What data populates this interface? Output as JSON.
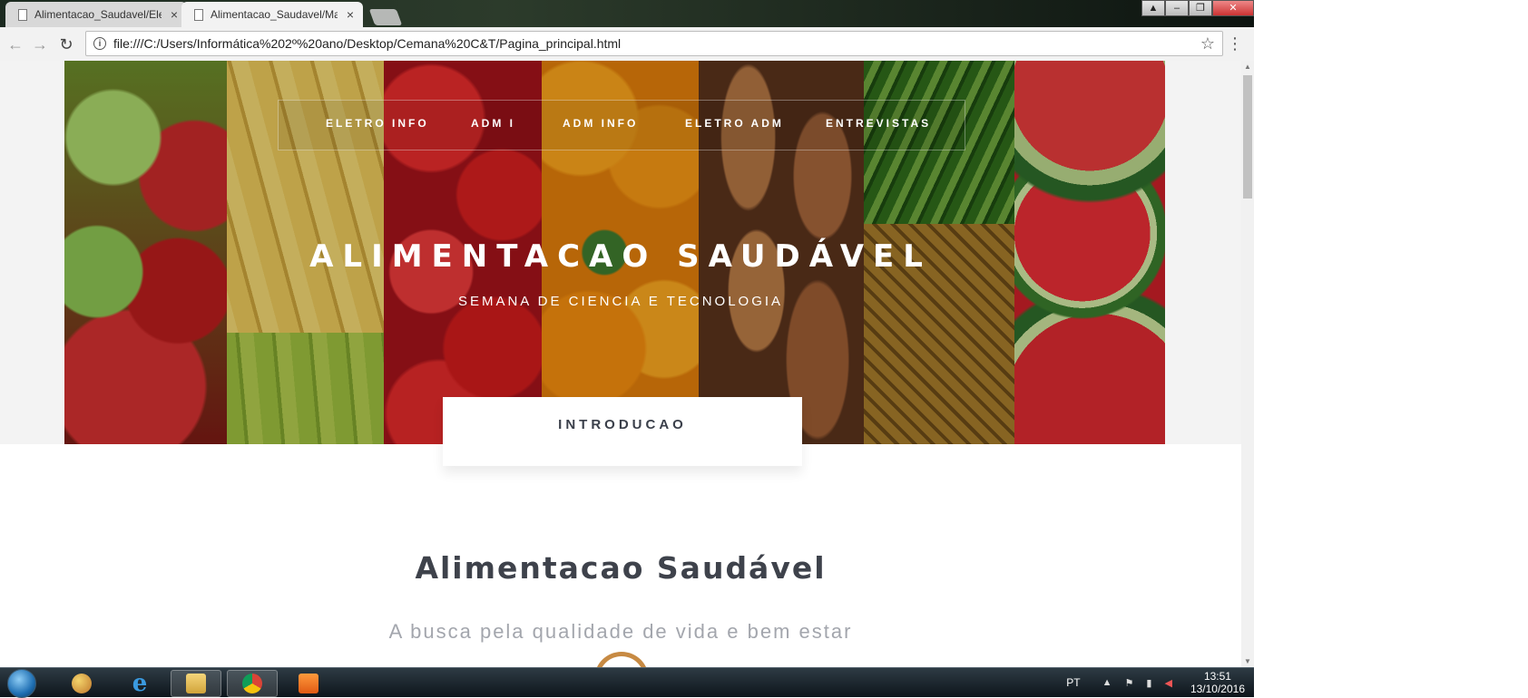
{
  "browser": {
    "tabs": [
      {
        "title": "Alimentacao_Saudavel/Eletro",
        "close": "×",
        "active": false
      },
      {
        "title": "Alimentacao_Saudavel/Main",
        "close": "×",
        "active": true
      }
    ],
    "window_controls": {
      "minimize": "–",
      "maximize": "❐",
      "close": "✕"
    },
    "address": "file:///C:/Users/Informática%202º%20ano/Desktop/Cemana%20C&T/Pagina_principal.html",
    "info_glyph": "i",
    "star_glyph": "☆",
    "menu_glyph": "⋮",
    "back_glyph": "←",
    "forward_glyph": "→",
    "reload_glyph": "↻"
  },
  "page": {
    "nav": [
      "ELETRO INFO",
      "ADM I",
      "ADM INFO",
      "ELETRO ADM",
      "ENTREVISTAS"
    ],
    "hero_title": "ALIMENTACAO SAUDÁVEL",
    "hero_subtitle": "SEMANA DE CIENCIA E TECNOLOGIA",
    "intro_tab": "INTRODUCAO",
    "section_title": "Alimentacao Saudável",
    "section_subtitle": "A busca pela qualidade de vida e bem estar"
  },
  "taskbar": {
    "language": "PT",
    "time": "13:51",
    "date": "13/10/2016",
    "icons": [
      "start-orb",
      "paint-icon",
      "internet-explorer-icon",
      "file-explorer-icon",
      "chrome-icon",
      "media-player-icon"
    ]
  },
  "colors": {
    "hero_text": "#ffffff",
    "section_title": "#3e424b",
    "section_subtitle": "#a3a6ad",
    "intro_label": "#3a3f4a"
  }
}
